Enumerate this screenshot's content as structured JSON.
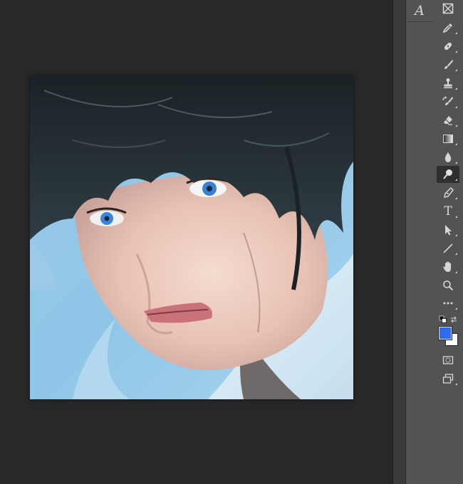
{
  "panel": {
    "character_panel_glyph": "A",
    "character_panel_icon": "character-panel-icon"
  },
  "toolbar": {
    "tools": [
      {
        "name": "frame-tool",
        "icon": "frame-icon"
      },
      {
        "name": "eyedropper-tool",
        "icon": "eyedropper-icon"
      },
      {
        "name": "healing-brush-tool",
        "icon": "bandage-icon"
      },
      {
        "name": "brush-tool",
        "icon": "brush-icon"
      },
      {
        "name": "clone-stamp-tool",
        "icon": "stamp-icon"
      },
      {
        "name": "history-brush-tool",
        "icon": "history-brush-icon"
      },
      {
        "name": "eraser-tool",
        "icon": "eraser-icon"
      },
      {
        "name": "gradient-tool",
        "icon": "gradient-icon"
      },
      {
        "name": "blur-tool",
        "icon": "drop-icon"
      },
      {
        "name": "dodge-tool",
        "icon": "dodge-icon",
        "active": true
      },
      {
        "name": "pen-tool",
        "icon": "pen-icon"
      },
      {
        "name": "type-tool",
        "icon": "type-icon"
      },
      {
        "name": "path-selection-tool",
        "icon": "arrow-icon"
      },
      {
        "name": "line-tool",
        "icon": "line-icon"
      },
      {
        "name": "hand-tool",
        "icon": "hand-icon"
      },
      {
        "name": "zoom-tool",
        "icon": "magnifier-icon"
      },
      {
        "name": "edit-toolbar",
        "icon": "more-icon"
      }
    ],
    "type_glyph": "T",
    "colors": {
      "foreground": "#2f6cf2",
      "background": "#ffffff"
    }
  },
  "colors": {
    "canvas_background": "#282828",
    "panel_background": "#535353",
    "active_tool_background": "#2f2f2f"
  }
}
